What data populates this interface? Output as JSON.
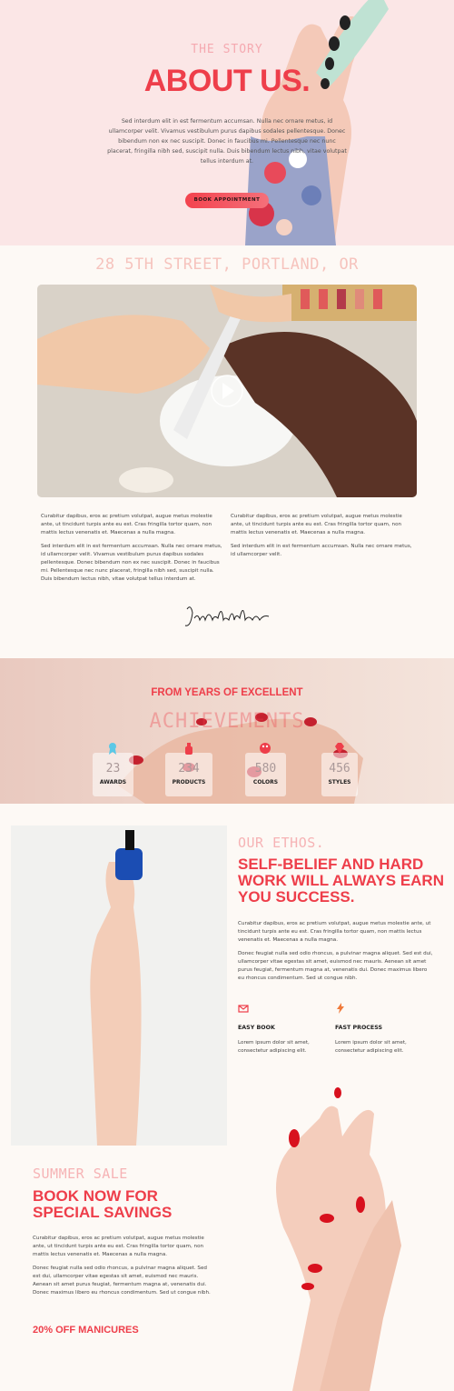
{
  "hero": {
    "eyebrow": "THE STORY",
    "title": "ABOUT US.",
    "paragraph": "Sed interdum elit in est fermentum accumsan. Nulla nec ornare metus, id ullamcorper velit. Vivamus vestibulum purus dapibus sodales pellentesque. Donec bibendum non ex nec suscipit. Donec in faucibus mi. Pellentesque nec nunc placerat, fringilla nibh sed, suscipit nulla. Duis bibendum lectus nibh, vitae volutpat tellus interdum at.",
    "cta_label": "BOOK APPOINTMENT"
  },
  "address": "28 5TH STREET, PORTLAND, OR",
  "columns": {
    "left": [
      "Curabitur dapibus, eros ac pretium volutpat, augue metus molestie ante, ut tincidunt turpis ante eu est. Cras fringilla tortor quam, non mattis lectus venenatis et. Maecenas a nulla magna.",
      "Sed interdum elit in est fermentum accumsan. Nulla nec ornare metus, id ullamcorper velit. Vivamus vestibulum purus dapibus sodales pellentesque. Donec bibendum non ex nec suscipit. Donec in faucibus mi. Pellentesque nec nunc placerat, fringilla nibh sed, suscipit nulla. Duis bibendum lectus nibh, vitae volutpat tellus interdum at."
    ],
    "right": [
      "Curabitur dapibus, eros ac pretium volutpat, augue metus molestie ante, ut tincidunt turpis ante eu est. Cras fringilla tortor quam, non mattis lectus venenatis et. Maecenas a nulla magna.",
      "Sed interdum elit in est fermentum accumsan. Nulla nec ornare metus, id ullamcorper velit."
    ]
  },
  "signature": "JaneMicheleDoe",
  "achievements": {
    "title_line1": "FROM YEARS OF EXCELLENT",
    "title_line2": "ACHIEVEMENTS",
    "stats": [
      {
        "value": "23",
        "label": "AWARDS",
        "icon": "ribbon-icon",
        "color": "#5bc8e6"
      },
      {
        "value": "234",
        "label": "PRODUCTS",
        "icon": "bottle-icon",
        "color": "#ee3e4a"
      },
      {
        "value": "580",
        "label": "COLORS",
        "icon": "palette-icon",
        "color": "#ee3e4a"
      },
      {
        "value": "456",
        "label": "STYLES",
        "icon": "diamond-icon",
        "color": "#ee3e4a"
      }
    ]
  },
  "ethos": {
    "eyebrow": "OUR ETHOS.",
    "title": "SELF-BELIEF AND HARD WORK WILL ALWAYS EARN YOU SUCCESS.",
    "paragraphs": [
      "Curabitur dapibus, eros ac pretium volutpat, augue metus molestie ante, ut tincidunt turpis ante eu est. Cras fringilla tortor quam, non mattis lectus venenatis et. Maecenas a nulla magna.",
      "Donec feugiat nulla sed odio rhoncus, a pulvinar magna aliquet. Sed est dui, ullamcorper vitae egestas sit amet, euismod nec mauris. Aenean sit amet purus feugiat, fermentum magna at, venenatis dui. Donec maximus libero eu rhoncus condimentum. Sed ut congue nibh."
    ],
    "features": [
      {
        "icon": "envelope-icon",
        "name": "EASY BOOK",
        "desc": "Lorem ipsum dolor sit amet, consectetur adipiscing elit."
      },
      {
        "icon": "lightning-icon",
        "name": "FAST PROCESS",
        "desc": "Lorem ipsum dolor sit amet, consectetur adipiscing elit."
      }
    ]
  },
  "sale": {
    "eyebrow": "SUMMER SALE",
    "title": "BOOK NOW FOR SPECIAL SAVINGS",
    "paragraphs": [
      "Curabitur dapibus, eros ac pretium volutpat, augue metus molestie ante, ut tincidunt turpis ante eu est. Cras fringilla tortor quam, non mattis lectus venenatis et. Maecenas a nulla magna.",
      "Donec feugiat nulla sed odio rhoncus, a pulvinar magna aliquet. Sed est dui, ullamcorper vitae egestas sit amet, euismod nec mauris. Aenean sit amet purus feugiat, fermentum magna at, venenatis dui. Donec maximus libero eu rhoncus condimentum. Sed ut congue nibh."
    ],
    "offer": "20% OFF MANICURES"
  },
  "colors": {
    "accent": "#ee3e4a",
    "soft_pink": "#fbe6e6",
    "cream": "#fdf9f5"
  }
}
